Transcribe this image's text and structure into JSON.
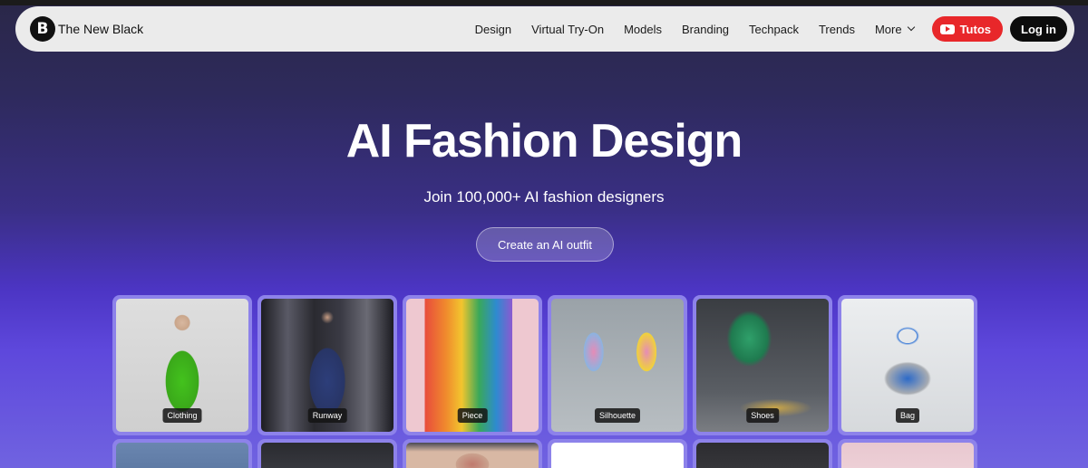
{
  "nav": {
    "brand_logo": "B",
    "brand_name": "The New Black",
    "links": [
      "Design",
      "Virtual Try-On",
      "Models",
      "Branding",
      "Techpack",
      "Trends",
      "More"
    ],
    "tutos_label": "Tutos",
    "login_label": "Log in"
  },
  "hero": {
    "title": "AI Fashion Design",
    "subtitle": "Join 100,000+ AI fashion designers",
    "cta_label": "Create an AI outfit"
  },
  "categories": [
    {
      "label": "Clothing"
    },
    {
      "label": "Runway"
    },
    {
      "label": "Piece"
    },
    {
      "label": "Silhouette"
    },
    {
      "label": "Shoes"
    },
    {
      "label": "Bag"
    }
  ],
  "colors": {
    "accent_red": "#e8272a",
    "card_border": "#8d82ea",
    "navbar_bg": "#ebebeb"
  }
}
